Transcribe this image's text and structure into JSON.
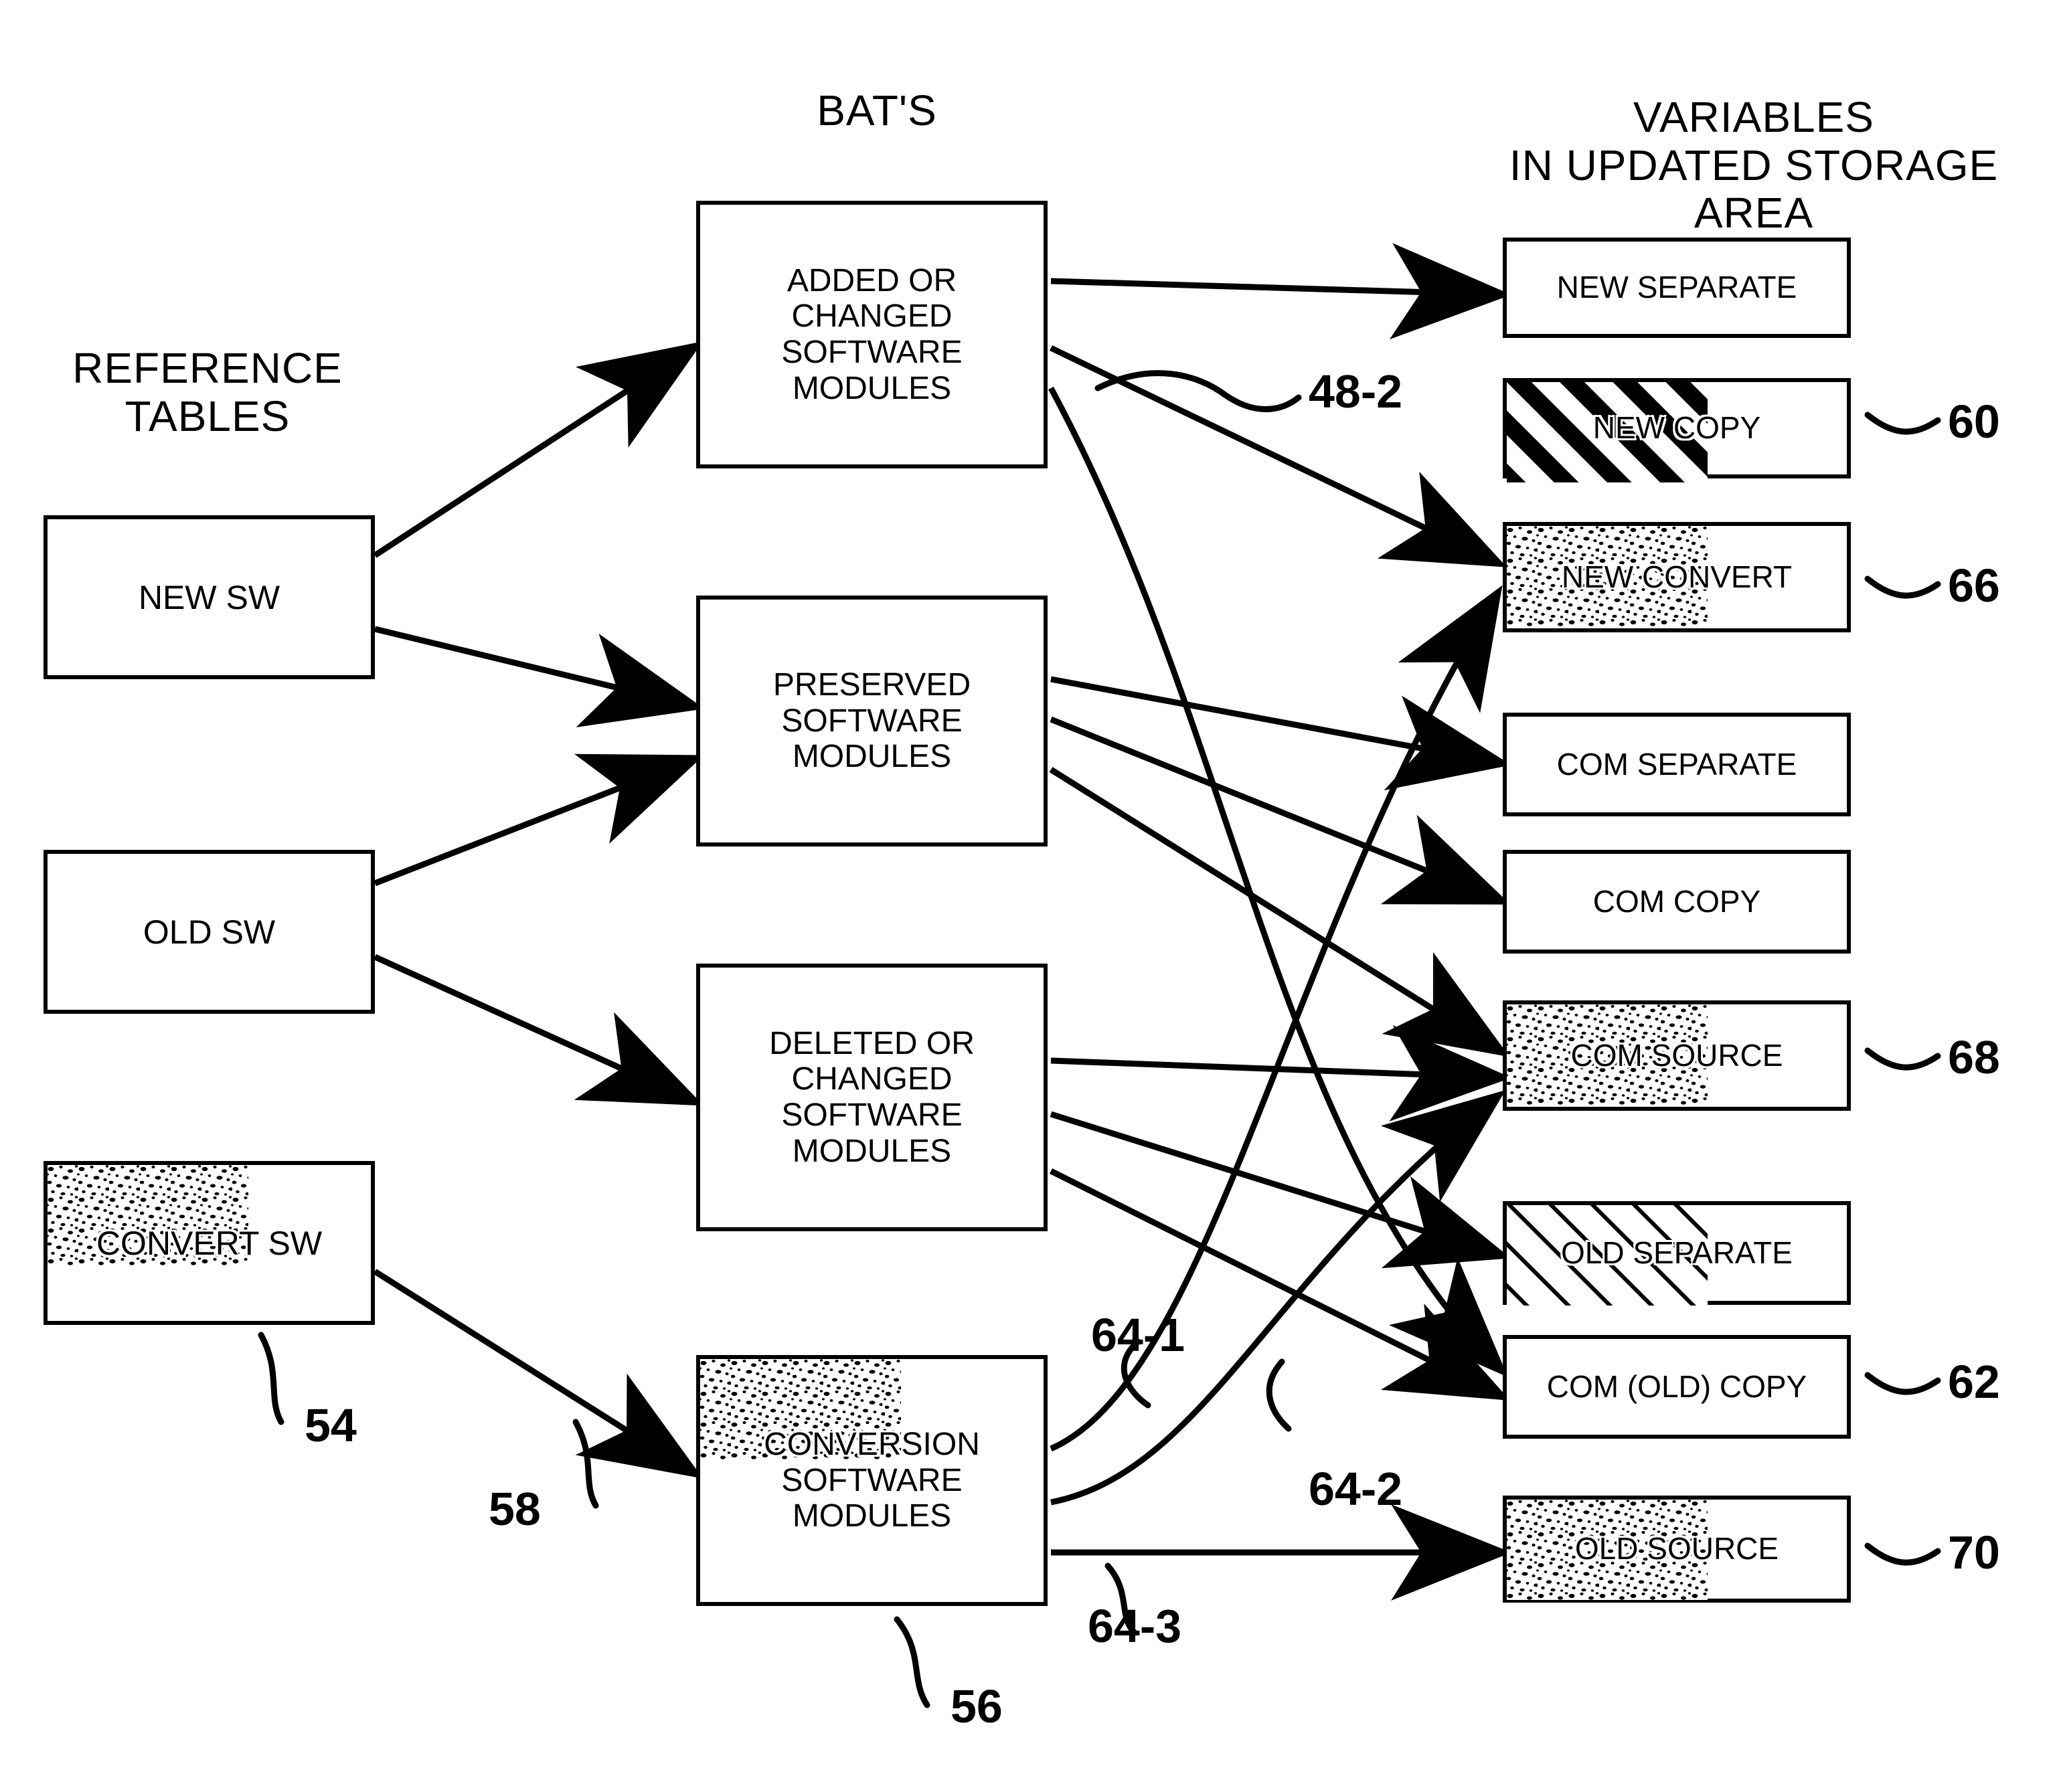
{
  "headers": {
    "left": "REFERENCE\nTABLES",
    "center": "BAT'S",
    "right": "VARIABLES\nIN UPDATED STORAGE AREA"
  },
  "reference_tables": [
    {
      "label": "NEW SW",
      "fill": "plain",
      "ref": null
    },
    {
      "label": "OLD SW",
      "fill": "plain",
      "ref": null
    },
    {
      "label": "CONVERT SW",
      "fill": "stipple",
      "ref": "54"
    }
  ],
  "bats": [
    {
      "label": "ADDED OR\nCHANGED\nSOFTWARE\nMODULES",
      "fill": "plain",
      "ref": null
    },
    {
      "label": "PRESERVED\nSOFTWARE\nMODULES",
      "fill": "plain",
      "ref": null
    },
    {
      "label": "DELETED OR\nCHANGED\nSOFTWARE\nMODULES",
      "fill": "plain",
      "ref": null
    },
    {
      "label": "CONVERSION\nSOFTWARE\nMODULES",
      "fill": "stipple",
      "ref": "56"
    }
  ],
  "variables": [
    {
      "label": "NEW SEPARATE",
      "fill": "plain",
      "ref": null
    },
    {
      "label": "NEW COPY",
      "fill": "hatch",
      "ref": "60"
    },
    {
      "label": "NEW CONVERT",
      "fill": "stipple",
      "ref": "66"
    },
    {
      "label": "COM SEPARATE",
      "fill": "plain",
      "ref": null
    },
    {
      "label": "COM COPY",
      "fill": "plain",
      "ref": null
    },
    {
      "label": "COM SOURCE",
      "fill": "stipple",
      "ref": "68"
    },
    {
      "label": "OLD SEPARATE",
      "fill": "hatch-thin",
      "ref": null
    },
    {
      "label": "COM (OLD) COPY",
      "fill": "plain",
      "ref": "62"
    },
    {
      "label": "OLD SOURCE",
      "fill": "stipple",
      "ref": "70"
    }
  ],
  "callouts": {
    "c48_2": "48-2",
    "c54": "54",
    "c56": "56",
    "c58": "58",
    "c60": "60",
    "c62": "62",
    "c64_1": "64-1",
    "c64_2": "64-2",
    "c64_3": "64-3",
    "c66": "66",
    "c68": "68",
    "c70": "70"
  },
  "colors": {
    "ink": "#000000",
    "paper": "#ffffff"
  }
}
